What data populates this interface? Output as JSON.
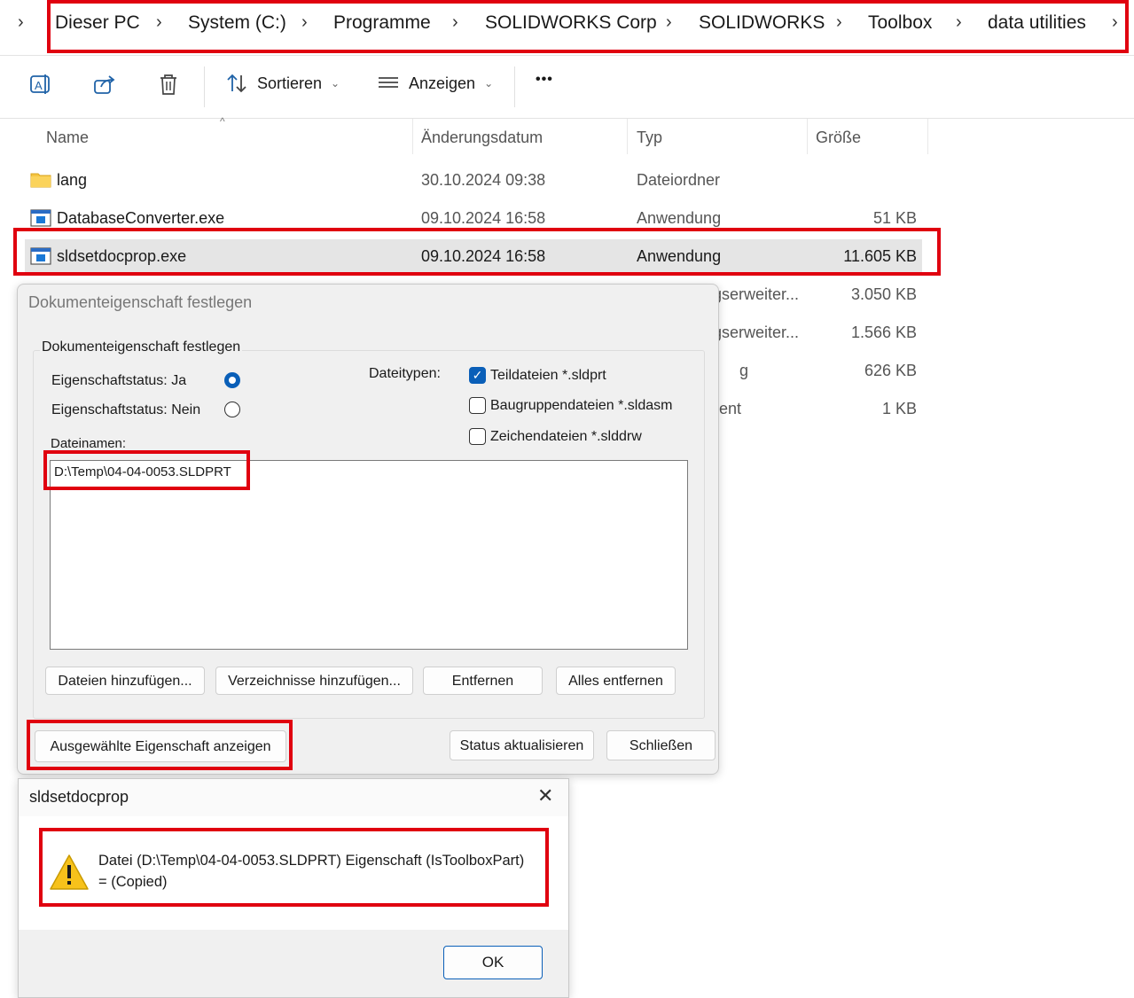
{
  "breadcrumb": {
    "items": [
      "Dieser PC",
      "System (C:)",
      "Programme",
      "SOLIDWORKS Corp",
      "SOLIDWORKS",
      "Toolbox",
      "data utilities"
    ]
  },
  "toolbar": {
    "sort_label": "Sortieren",
    "view_label": "Anzeigen",
    "more_label": "•••"
  },
  "file_list": {
    "columns": [
      "Name",
      "Änderungsdatum",
      "Typ",
      "Größe"
    ],
    "rows": [
      {
        "name": "lang",
        "date": "30.10.2024 09:38",
        "type": "Dateiordner",
        "size": "",
        "icon": "folder-icon"
      },
      {
        "name": "DatabaseConverter.exe",
        "date": "09.10.2024 16:58",
        "type": "Anwendung",
        "size": "51 KB",
        "icon": "exe-icon"
      },
      {
        "name": "sldsetdocprop.exe",
        "date": "09.10.2024 16:58",
        "type": "Anwendung",
        "size": "11.605 KB",
        "icon": "exe-icon"
      },
      {
        "name": "",
        "date": "",
        "type": "gserweiter...",
        "size": "3.050 KB",
        "icon": ""
      },
      {
        "name": "",
        "date": "",
        "type": "gserweiter...",
        "size": "1.566 KB",
        "icon": ""
      },
      {
        "name": "",
        "date": "",
        "type": "g",
        "size": "626 KB",
        "icon": ""
      },
      {
        "name": "",
        "date": "",
        "type": "ent",
        "size": "1 KB",
        "icon": ""
      }
    ]
  },
  "dialog_main": {
    "title": "Dokumenteigenschaft festlegen",
    "group_label": "Dokumenteigenschaft festlegen",
    "radio_yes": "Eigenschaftstatus: Ja",
    "radio_no": "Eigenschaftstatus: Nein",
    "filetypes_label": "Dateitypen:",
    "check_parts": "Teildateien *.sldprt",
    "check_assemblies": "Baugruppendateien *.sldasm",
    "check_drawings": "Zeichendateien *.slddrw",
    "filenames_label": "Dateinamen:",
    "filenames": [
      "D:\\Temp\\04-04-0053.SLDPRT"
    ],
    "btn_add_files": "Dateien hinzufügen...",
    "btn_add_dirs": "Verzeichnisse hinzufügen...",
    "btn_remove": "Entfernen",
    "btn_remove_all": "Alles entfernen",
    "btn_show_property": "Ausgewählte Eigenschaft anzeigen",
    "btn_update_status": "Status aktualisieren",
    "btn_close": "Schließen"
  },
  "dialog_msg": {
    "title": "sldsetdocprop",
    "message_line1": "Datei (D:\\Temp\\04-04-0053.SLDPRT) Eigenschaft (IsToolboxPart)",
    "message_line2": "= (Copied)",
    "ok_label": "OK"
  },
  "colors": {
    "highlight_red": "#e0000f",
    "accent_blue": "#0a5fb8",
    "warning_yellow": "#f7c21b"
  }
}
